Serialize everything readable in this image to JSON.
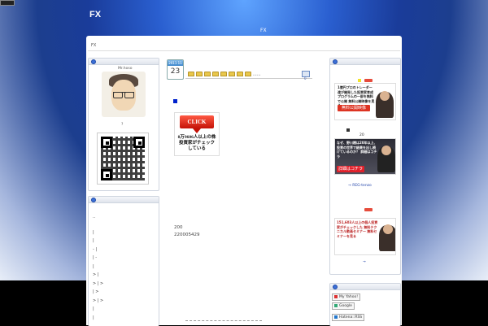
{
  "header": {
    "site_title": "FX",
    "site_subtitle": "FX",
    "breadcrumb": "FX"
  },
  "profile": {
    "name": "Mr.hoso",
    "caption": "?"
  },
  "left_links": [
    "..",
    "|",
    "|",
    "- |",
    "| -",
    "|",
    "> |",
    "> | >",
    "| >",
    "> | >",
    "|",
    "|"
  ],
  "entry": {
    "year_month": "2011 11",
    "day": "23",
    "title_dots": "......",
    "comment_count": "0",
    "click_label": "CLICK",
    "click_caption": "8万9606人以上の株投資家がチェックしている",
    "body_line1": "200",
    "body_line2": "220005429"
  },
  "right_sidebar": {
    "ad1_text": "1億円プロのトレーダー達が開発した投資家育成プログラムの一部を無料で公開 無料公開映像を見る",
    "ad1_button": "無料公開映像",
    "label_20": "20",
    "ad2_text": "なぜ、野川樹は20年以上、投資の世界で結果を出し続けているのか？ 詳細はコチラ",
    "ad2_button": "詳細はコチラ",
    "ad2_link": "→ REG-tenzo",
    "ad3_text": "151,603人以上の個人投資家がチェックした 無料テクニカル動画セミナー 無料セミナーを見る",
    "ad3_link": "→",
    "bookmarks": [
      "My Yahoo!",
      "Google",
      "Hatena::RSS"
    ]
  },
  "colors": {
    "accent": "#3b6fd6",
    "click_red": "#c41207",
    "ad_red": "#e64c3c"
  }
}
